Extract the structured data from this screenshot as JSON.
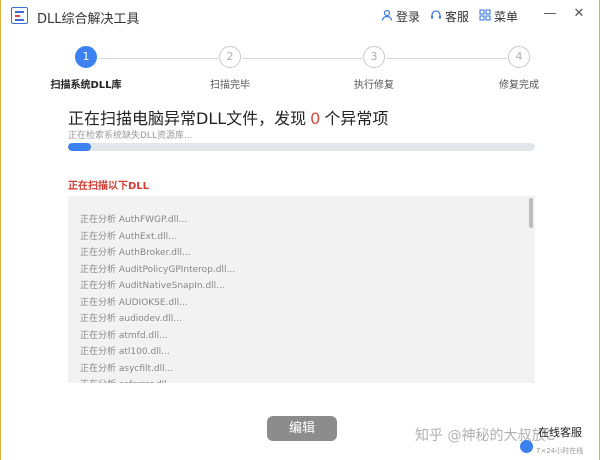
{
  "window": {
    "title": "DLL综合解决工具",
    "login": "登录",
    "service": "客服",
    "menu": "菜单",
    "minimize": "—",
    "close": "✕"
  },
  "steps": [
    {
      "num": "1",
      "label": "扫描系统DLL库",
      "active": true
    },
    {
      "num": "2",
      "label": "扫描完毕",
      "active": false
    },
    {
      "num": "3",
      "label": "执行修复",
      "active": false
    },
    {
      "num": "4",
      "label": "修复完成",
      "active": false
    }
  ],
  "scan": {
    "headline_prefix": "正在扫描电脑异常DLL文件，发现",
    "found_count": "0",
    "headline_suffix": "个异常项",
    "subline": "正在检索系统缺失DLL资源库...",
    "progress": 0.05
  },
  "list": {
    "title": "正在扫描以下DLL",
    "items": [
      "正在分析 AuthFWGP.dll...",
      "正在分析 AuthExt.dll...",
      "正在分析 AuthBroker.dll...",
      "正在分析 AuditPolicyGPInterop.dll...",
      "正在分析 AuditNativeSnapIn.dll...",
      "正在分析 AUDIOKSE.dll...",
      "正在分析 audiodev.dll...",
      "正在分析 atmfd.dll...",
      "正在分析 atl100.dll...",
      "正在分析 asycfilt.dll...",
      "正在分析 asferror.dll..."
    ]
  },
  "footer": {
    "edit_button": "编辑",
    "watermark": "知乎 @神秘的大叔放C",
    "online_service": "在线客服",
    "online_sub": "7×24小时在线"
  },
  "colors": {
    "accent": "#3b82f0",
    "alert": "#e0463d"
  }
}
